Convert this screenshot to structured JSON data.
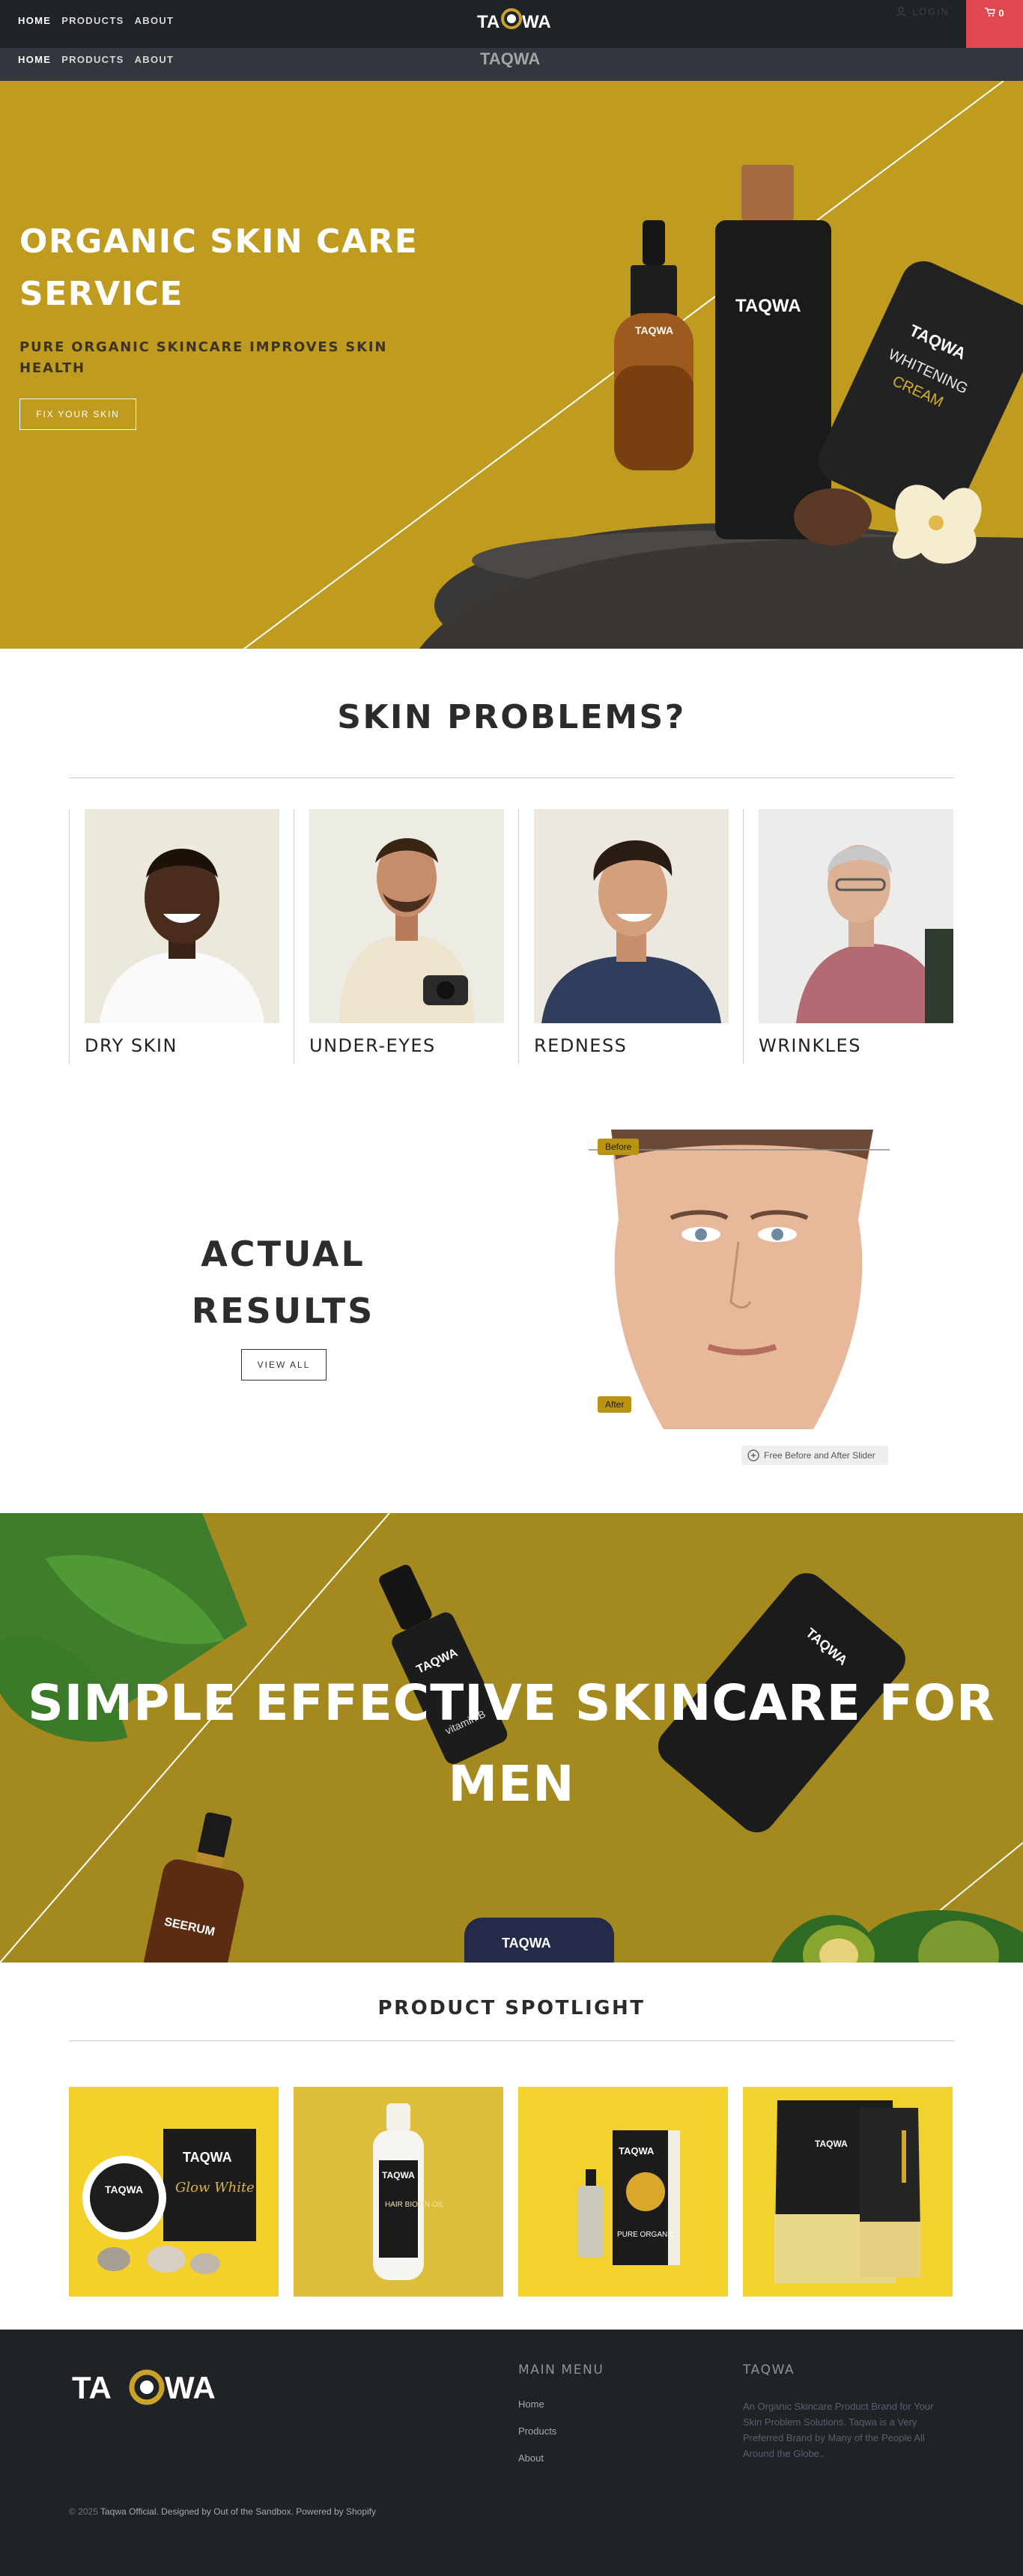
{
  "nav": {
    "links": [
      "HOME",
      "PRODUCTS",
      "ABOUT"
    ],
    "brand": "TAQWA",
    "login": "LOGIN",
    "cart_count": "0"
  },
  "hero": {
    "title_line1": "ORGANIC SKIN CARE",
    "title_line2": "SERVICE",
    "subtitle_line1": "PURE ORGANIC SKINCARE IMPROVES SKIN",
    "subtitle_line2": "HEALTH",
    "button": "FIX YOUR SKIN",
    "product_label_brand": "TAQWA",
    "product_label_cream_1": "WHITENING",
    "product_label_cream_2": "CREAM"
  },
  "skin_problems": {
    "title": "SKIN PROBLEMS?",
    "items": [
      "DRY SKIN",
      "UNDER-EYES",
      "REDNESS",
      "WRINKLES"
    ]
  },
  "results": {
    "title_line1": "ACTUAL",
    "title_line2": "RESULTS",
    "button": "VIEW ALL",
    "before_label": "Before",
    "after_label": "After",
    "credit": "Free Before and After Slider"
  },
  "men_banner": {
    "title_line1": "SIMPLE EFFECTIVE SKINCARE FOR",
    "title_line2": "MEN",
    "serum_label": "SEERUM",
    "vitamin_label": "vitamin B"
  },
  "spotlight": {
    "title": "PRODUCT SPOTLIGHT",
    "products": [
      {
        "brand": "TAQWA",
        "name": "Glow White"
      },
      {
        "brand": "TAQWA",
        "name": "HAIR BIOTIN OIL"
      },
      {
        "brand": "TAQWA",
        "name": "PURE ORGANIC"
      },
      {
        "brand": "TAQWA",
        "name": ""
      }
    ]
  },
  "footer": {
    "brand": "TAQWA",
    "menu_heading": "MAIN MENU",
    "menu_links": [
      "Home",
      "Products",
      "About"
    ],
    "about_heading": "TAQWA",
    "about_text": "An Organic Skincare Product Brand for Your Skin Problem Solutions. Taqwa is a Very Preferred Brand by Many of the People All Around the Globe..",
    "copyright_prefix": "© 2025 ",
    "copyright_link": "Taqwa Official",
    "copyright_suffix": ". Designed by Out of the Sandbox. Powered by Shopify"
  },
  "colors": {
    "hero_gold": "#bf9b1f",
    "banner_gold": "#a48a1e",
    "dark": "#1f2227",
    "cart_red": "#e1474f",
    "spotlight_yellow": "#f2d12d"
  }
}
